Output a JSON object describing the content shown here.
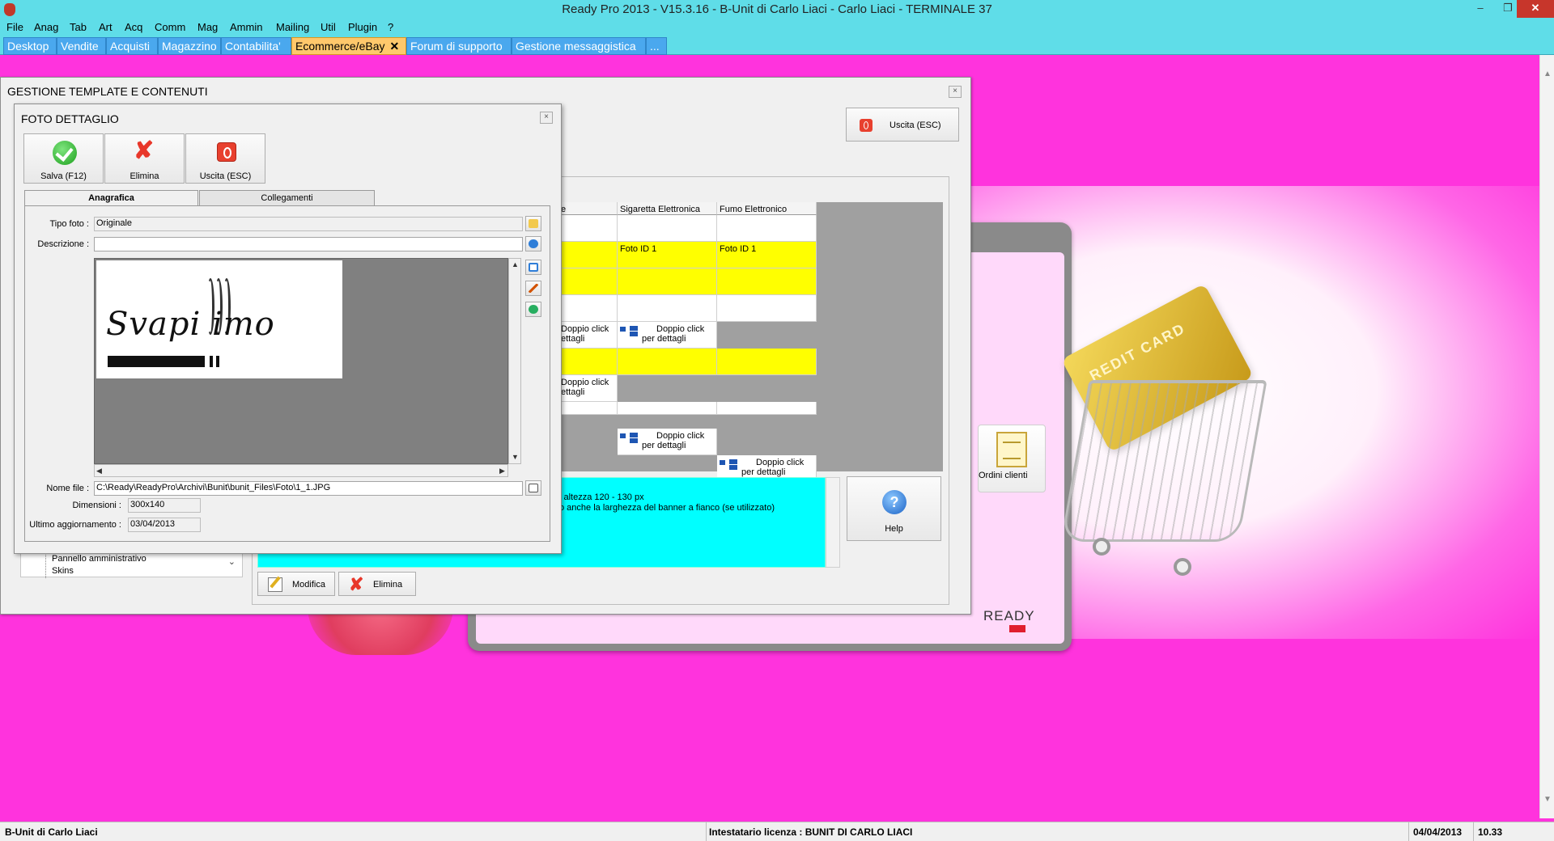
{
  "window": {
    "title": "Ready Pro 2013 - V15.3.16 - B-Unit di Carlo Liaci - Carlo Liaci - TERMINALE 37",
    "minimize": "–",
    "restore": "❐",
    "close": "✕"
  },
  "menu": [
    "File",
    "Anag",
    "Tab",
    "Art",
    "Acq",
    "Comm",
    "Mag",
    "Ammin",
    "Mailing",
    "Util",
    "Plugin",
    "?"
  ],
  "tabs": [
    "Desktop",
    "Vendite",
    "Acquisti",
    "Magazzino",
    "Contabilita'",
    "Ecommerce/eBay",
    "Forum di supporto",
    "Gestione messaggistica",
    "..."
  ],
  "active_tab_close": "✕",
  "main_dialog": {
    "title": "GESTIONE TEMPLATE E CONTENUTI",
    "exit_label": "Uscita (ESC)",
    "grid": {
      "col_partial": "e",
      "col2": "Sigaretta Elettronica",
      "col3": "Fumo Elettronico",
      "foto_id": "Foto ID 1",
      "dc1": "Doppio click",
      "dc2": "per dettagli",
      "dc2_partial": "ettagli"
    },
    "info_line1": "i altezza 120 - 130 px",
    "info_line2": "o anche la larghezza del banner a fianco (se utilizzato)",
    "help_label": "Help",
    "modifica_label": "Modifica",
    "elimina_label": "Elimina",
    "tree_item1": "Pannello amministrativo",
    "tree_item2": "Skins"
  },
  "foto_dialog": {
    "title": "FOTO DETTAGLIO",
    "save_label": "Salva (F12)",
    "delete_label": "Elimina",
    "exit_label": "Uscita (ESC)",
    "tab1": "Anagrafica",
    "tab2": "Collegamenti",
    "tipo_foto_label": "Tipo foto :",
    "tipo_foto_value": "Originale",
    "descrizione_label": "Descrizione :",
    "descrizione_value": "",
    "nome_file_label": "Nome file :",
    "nome_file_value": "C:\\Ready\\ReadyPro\\Archivi\\Bunit\\bunit_Files\\Foto\\1_1.JPG",
    "dimensioni_label": "Dimensioni :",
    "dimensioni_value": "300x140",
    "ultimo_label": "Ultimo aggiornamento :",
    "ultimo_value": "03/04/2013",
    "logo_text": "Svapi imo"
  },
  "desktop": {
    "ordini_label": "Ordini clienti",
    "ready_logo": "READY",
    "card_text": "REDIT CARD"
  },
  "statusbar": {
    "company": "B-Unit di Carlo Liaci",
    "license": "Intestatario licenza : BUNIT DI CARLO LIACI",
    "date": "04/04/2013",
    "time": "10.33"
  },
  "colors": {
    "chrome": "#5fdde8",
    "desktop_bg": "#ff33dd",
    "highlight_row": "#ffff00",
    "info_box": "#00ffff",
    "active_tab": "#ffc86b"
  }
}
